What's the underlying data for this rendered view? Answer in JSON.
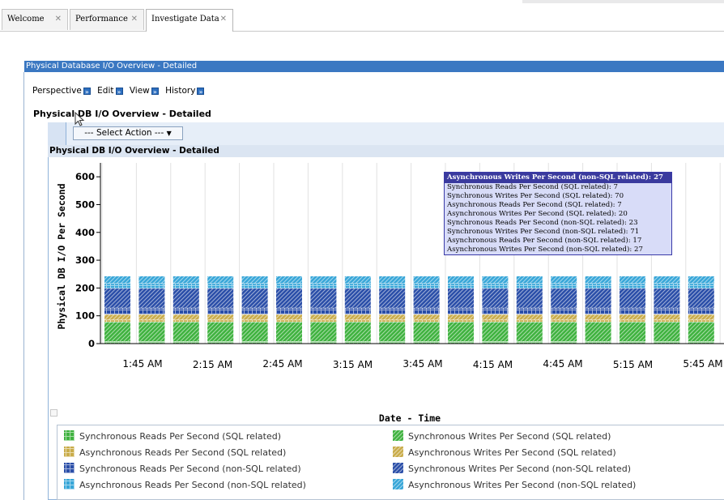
{
  "tabs": [
    {
      "label": "Welcome",
      "close": "✕",
      "active": false
    },
    {
      "label": "Performance",
      "close": "✕",
      "active": false
    },
    {
      "label": "Investigate Data",
      "close": "✕",
      "active": true
    }
  ],
  "panel_title": "Physical Database I/O Overview - Detailed",
  "menu": [
    {
      "label": "Perspective",
      "icon": "double-chevron-right-icon"
    },
    {
      "label": "Edit",
      "icon": "double-chevron-right-icon"
    },
    {
      "label": "View",
      "icon": "double-chevron-right-icon"
    },
    {
      "label": "History",
      "icon": "double-chevron-right-icon"
    }
  ],
  "subtitle": "Physical DB I/O Overview - Detailed",
  "select_action": "--- Select Action ---",
  "chart_title": "Physical DB I/O Overview - Detailed",
  "tooltip": {
    "header": "Asynchronous Writes Per Second (non-SQL related): 27",
    "lines": [
      "Synchronous Reads Per Second (SQL related): 7",
      "Synchronous Writes Per Second (SQL related): 70",
      "Asynchronous Reads Per Second (SQL related): 7",
      "Asynchronous Writes Per Second (SQL related): 20",
      "Synchronous Reads Per Second (non-SQL related): 23",
      "Synchronous Writes Per Second (non-SQL related): 71",
      "Asynchronous Reads Per Second (non-SQL related): 17",
      "Asynchronous Writes Per Second (non-SQL related): 27"
    ]
  },
  "chart_data": {
    "type": "bar",
    "stacked": true,
    "xlabel": "Date - Time",
    "ylabel": "Physical DB I/O Per Second",
    "ylim": [
      0,
      650
    ],
    "yticks": [
      0,
      100,
      200,
      300,
      400,
      500,
      600
    ],
    "xtick_labels": [
      "1:45 AM",
      "2:15 AM",
      "2:45 AM",
      "3:15 AM",
      "3:45 AM",
      "4:15 AM",
      "4:45 AM",
      "5:15 AM",
      "5:45 AM"
    ],
    "bar_count": 18,
    "grid": true,
    "legend_position": "bottom",
    "series": [
      {
        "name": "Synchronous Reads Per Second (SQL related)",
        "value": 7,
        "color": "#3fb23f",
        "pattern": "grid"
      },
      {
        "name": "Synchronous Writes Per Second (SQL related)",
        "value": 70,
        "color": "#3fb23f",
        "pattern": "hatch"
      },
      {
        "name": "Asynchronous Reads Per Second (SQL related)",
        "value": 7,
        "color": "#c9ac4a",
        "pattern": "grid"
      },
      {
        "name": "Asynchronous Writes Per Second (SQL related)",
        "value": 20,
        "color": "#c9ac4a",
        "pattern": "hatch"
      },
      {
        "name": "Synchronous Reads Per Second (non-SQL related)",
        "value": 23,
        "color": "#2a4ea8",
        "pattern": "grid"
      },
      {
        "name": "Synchronous Writes Per Second (non-SQL related)",
        "value": 71,
        "color": "#2a4ea8",
        "pattern": "hatch"
      },
      {
        "name": "Asynchronous Reads Per Second (non-SQL related)",
        "value": 17,
        "color": "#37a6d8",
        "pattern": "grid"
      },
      {
        "name": "Asynchronous Writes Per Second (non-SQL related)",
        "value": 27,
        "color": "#37a6d8",
        "pattern": "hatch"
      }
    ]
  }
}
